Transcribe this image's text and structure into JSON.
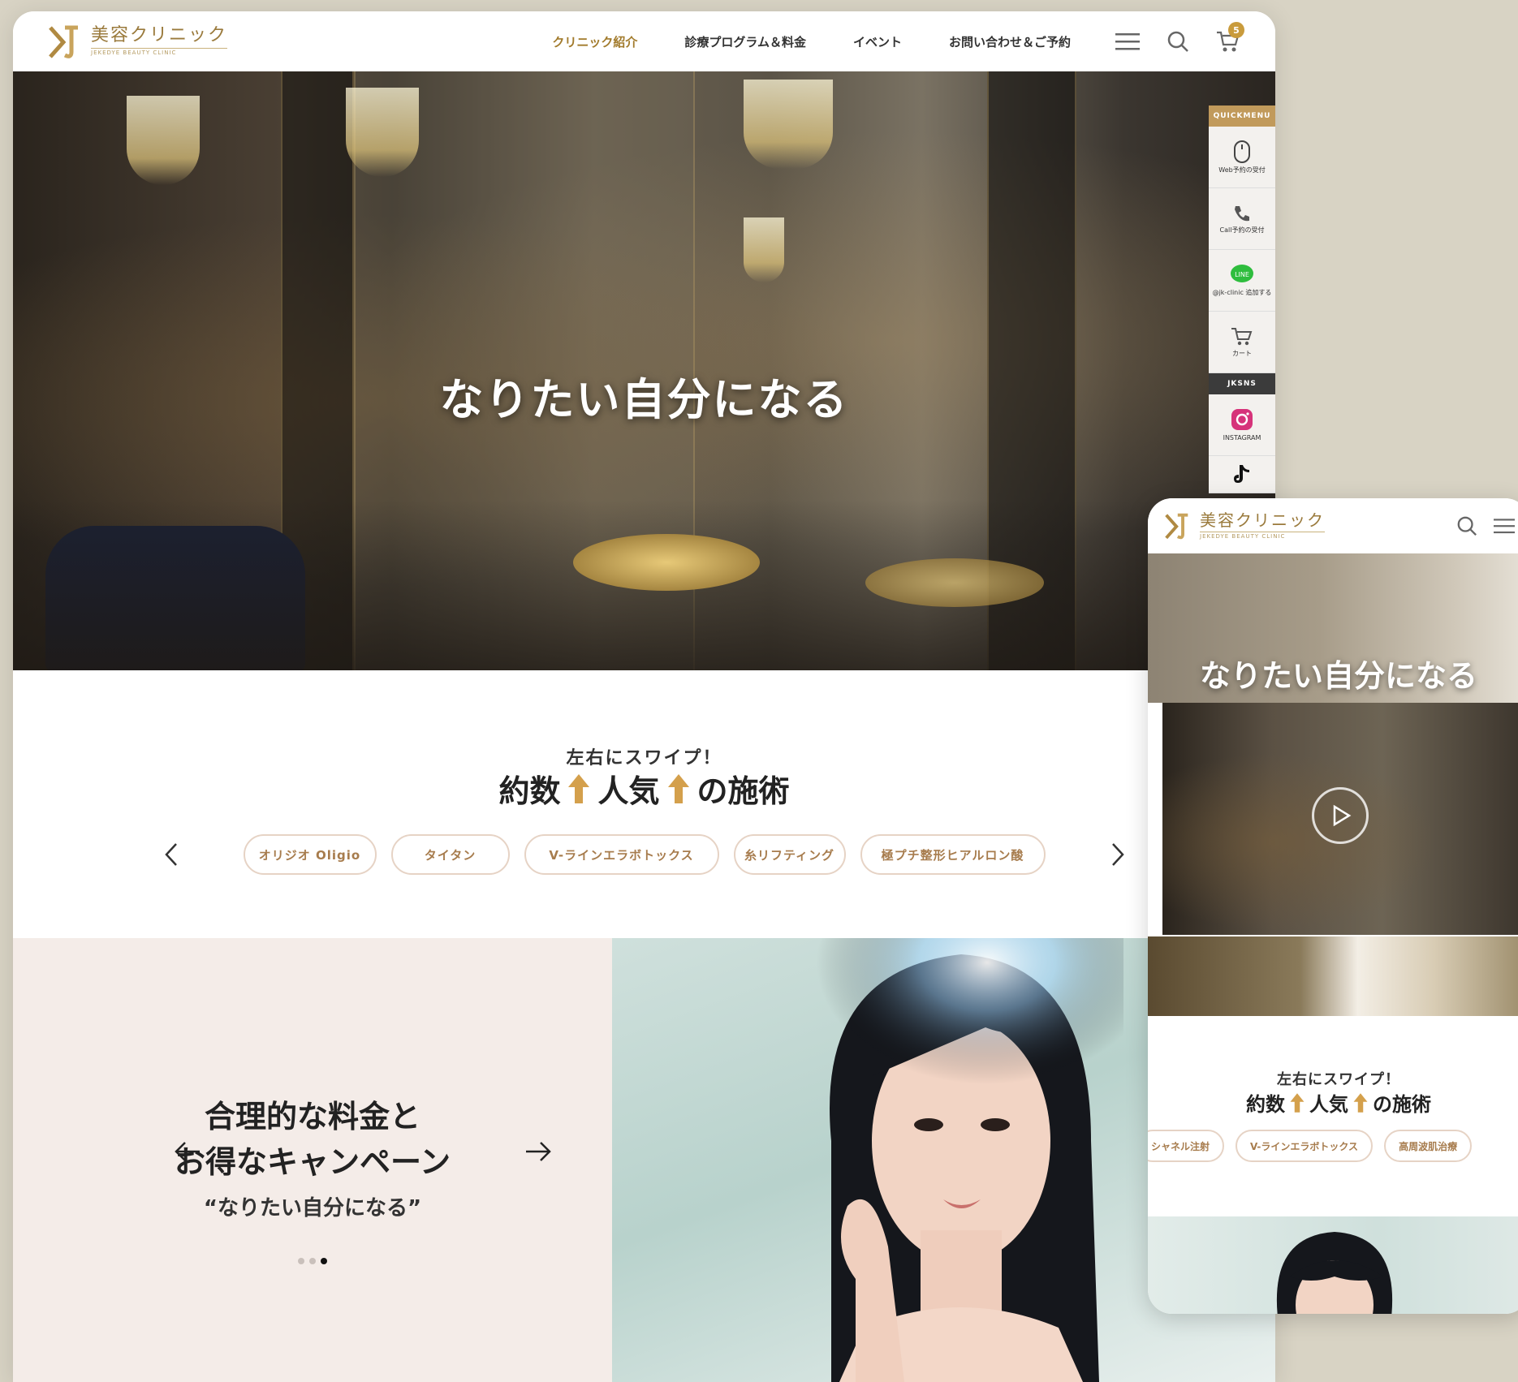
{
  "brand": {
    "name": "美容クリニック",
    "tagline": "JEKEDYE BEAUTY CLINIC"
  },
  "nav": {
    "items": [
      "クリニック紹介",
      "診療プログラム＆料金",
      "イベント",
      "お問い合わせ＆ご予約"
    ],
    "active": "クリニック紹介",
    "cart_count": "5"
  },
  "hero": {
    "headline": "なりたい自分になる"
  },
  "quick_menu": {
    "header": "QUICKMENU",
    "items": [
      "Web予約の受付",
      "Call予約の受付",
      "@jk-clinic 追加する",
      "カート"
    ],
    "sns_header": "JKSNS",
    "sns": [
      "INSTAGRAM",
      "TIKTOK"
    ]
  },
  "popular": {
    "subtitle": "左右にスワイプ！",
    "title_part1": "約数",
    "title_part2": "人気",
    "title_part3": "の施術",
    "chips": [
      "オリジオ Oligio",
      "タイタン",
      "V-ラインエラボトックス",
      "糸リフティング",
      "極プチ整形ヒアルロン酸"
    ]
  },
  "promo": {
    "line1": "合理的な料金と",
    "line2": "お得なキャンペーン",
    "quote": "“なりたい自分になる”",
    "slides": 3,
    "active_slide": 3
  },
  "mobile": {
    "brand": "美容クリニック",
    "headline": "なりたい自分になる",
    "popular_subtitle": "左右にスワイプ！",
    "title_part1": "約数",
    "title_part2": "人気",
    "title_part3": "の施術",
    "chips": [
      "シャネル注射",
      "V-ラインエラボトックス",
      "高周波肌治療"
    ]
  },
  "colors": {
    "gold": "#a27b2c",
    "chip_border": "#e6d3c5",
    "promo_bg": "#f4ece8",
    "page_bg": "#d8d3c4"
  }
}
